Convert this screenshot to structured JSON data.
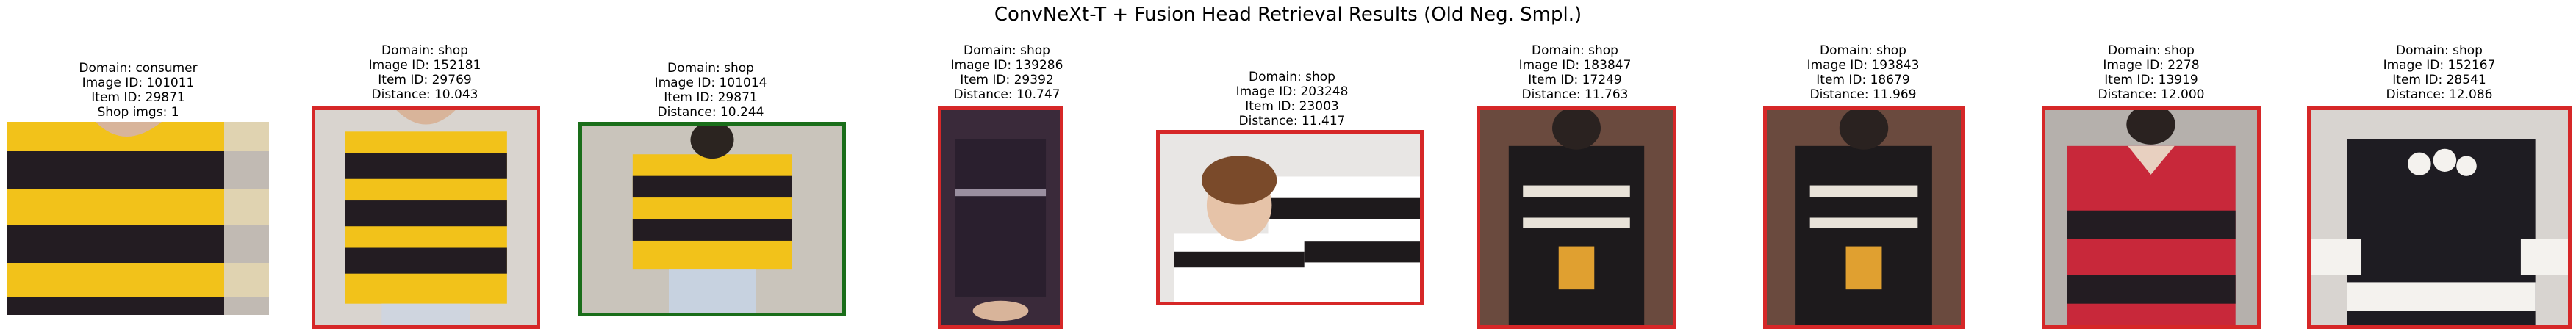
{
  "figure": {
    "title": "ConvNeXt-T + Fusion Head Retrieval Results (Old Neg. Smpl.)"
  },
  "query": {
    "domain_line": "Domain: consumer",
    "image_id_line": "Image ID: 101011",
    "item_id_line": "Item ID: 29871",
    "shop_imgs_line": "Shop imgs: 1",
    "image_description": "Person wearing yellow and black striped t-shirt"
  },
  "results": [
    {
      "domain_line": "Domain: shop",
      "image_id_line": "Image ID: 152181",
      "item_id_line": "Item ID: 29769",
      "distance_line": "Distance: 10.043",
      "match": false,
      "border_color": "#d62728"
    },
    {
      "domain_line": "Domain: shop",
      "image_id_line": "Image ID: 101014",
      "item_id_line": "Item ID: 29871",
      "distance_line": "Distance: 10.244",
      "match": true,
      "border_color": "#1a6e1a"
    },
    {
      "domain_line": "Domain: shop",
      "image_id_line": "Image ID: 139286",
      "item_id_line": "Item ID: 29392",
      "distance_line": "Distance: 10.747",
      "match": false,
      "border_color": "#d62728"
    },
    {
      "domain_line": "Domain: shop",
      "image_id_line": "Image ID: 203248",
      "item_id_line": "Item ID: 23003",
      "distance_line": "Distance: 11.417",
      "match": false,
      "border_color": "#d62728"
    },
    {
      "domain_line": "Domain: shop",
      "image_id_line": "Image ID: 183847",
      "item_id_line": "Item ID: 17249",
      "distance_line": "Distance: 11.763",
      "match": false,
      "border_color": "#d62728"
    },
    {
      "domain_line": "Domain: shop",
      "image_id_line": "Image ID: 193843",
      "item_id_line": "Item ID: 18679",
      "distance_line": "Distance: 11.969",
      "match": false,
      "border_color": "#d62728"
    },
    {
      "domain_line": "Domain: shop",
      "image_id_line": "Image ID: 2278",
      "item_id_line": "Item ID: 13919",
      "distance_line": "Distance: 12.000",
      "match": false,
      "border_color": "#d62728"
    },
    {
      "domain_line": "Domain: shop",
      "image_id_line": "Image ID: 152167",
      "item_id_line": "Item ID: 28541",
      "distance_line": "Distance: 12.086",
      "match": false,
      "border_color": "#d62728"
    }
  ],
  "colors": {
    "match_border": "#1a6e1a",
    "non_match_border": "#d62728",
    "yellow_stripe": "#f2c21a",
    "dark_stripe": "#231c22",
    "red_stripe": "#c8283a"
  }
}
